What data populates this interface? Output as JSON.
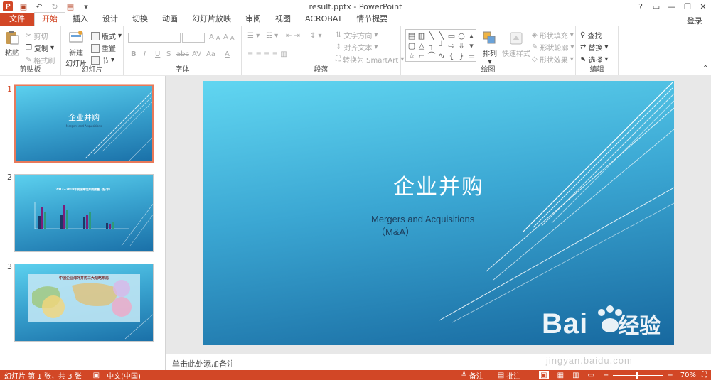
{
  "window": {
    "title": "result.pptx - PowerPoint",
    "help": "?",
    "login": "登录"
  },
  "tabs": [
    {
      "label": "文件"
    },
    {
      "label": "开始"
    },
    {
      "label": "插入"
    },
    {
      "label": "设计"
    },
    {
      "label": "切换"
    },
    {
      "label": "动画"
    },
    {
      "label": "幻灯片放映"
    },
    {
      "label": "审阅"
    },
    {
      "label": "视图"
    },
    {
      "label": "ACROBAT"
    },
    {
      "label": "情节提要"
    }
  ],
  "ribbon": {
    "clipboard": {
      "paste": "粘贴",
      "cut": "剪切",
      "copy": "复制",
      "format_painter": "格式刷",
      "group": "剪贴板"
    },
    "slides": {
      "new_slide": "新建",
      "new_slide2": "幻灯片",
      "layout": "版式",
      "reset": "重置",
      "section": "节",
      "group": "幻灯片"
    },
    "font": {
      "group": "字体",
      "bold": "B",
      "italic": "I",
      "underline": "U",
      "shadow": "S",
      "strike": "abc",
      "spacing": "AV",
      "case": "Aa",
      "color": "A"
    },
    "paragraph": {
      "text_direction": "文字方向",
      "align_text": "对齐文本",
      "smartart": "转换为 SmartArt",
      "group": "段落"
    },
    "drawing": {
      "arrange": "排列",
      "quick_styles": "快速样式",
      "fill": "形状填充",
      "outline": "形状轮廓",
      "effects": "形状效果",
      "group": "绘图"
    },
    "editing": {
      "find": "查找",
      "replace": "替换",
      "select": "选择",
      "group": "编辑"
    }
  },
  "thumbnails": [
    {
      "num": "1",
      "title": "企业并购",
      "sub": "Mergers and Acquisitions"
    },
    {
      "num": "2",
      "title": "2013~2019年我国跨境并购数量（起/年）"
    },
    {
      "num": "3",
      "title": "中国企业海外并购三大战略布局"
    }
  ],
  "slide": {
    "title": "企业并购",
    "sub_line1": "Mergers and Acquisitions",
    "sub_line2": "（M&A）"
  },
  "notes": {
    "placeholder": "单击此处添加备注"
  },
  "status": {
    "slide_info": "幻灯片 第 1 张，共 3 张",
    "language": "中文(中国)",
    "notes": "备注",
    "comments": "批注",
    "zoom": "70%"
  },
  "watermark": {
    "brand": "Bai",
    "brand2": "经验",
    "url": "jingyan.baidu.com"
  }
}
